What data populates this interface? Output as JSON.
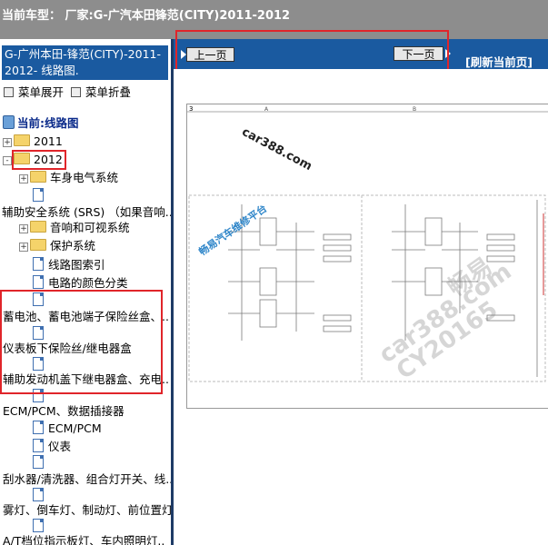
{
  "top_bar": {
    "text": "当前车型： 厂家:G-广汽本田锋范(CITY)2011-2012"
  },
  "left_panel": {
    "title": "G-广州本田-锋范(CITY)-2011-2012- 线路图.",
    "expand_label": "菜单展开",
    "collapse_label": "菜单折叠",
    "current_label": "当前:线路图",
    "tree": [
      {
        "label": "2011",
        "type": "folder",
        "toggle": "+"
      },
      {
        "label": "2012",
        "type": "folder",
        "toggle": "-"
      },
      {
        "label": "车身电气系统",
        "type": "folder",
        "toggle": "+"
      },
      {
        "label": "",
        "type": "doc"
      },
      {
        "label": "辅助安全系统 (SRS) （如果音响..",
        "type": "text"
      },
      {
        "label": "音响和可视系统",
        "type": "folder",
        "toggle": "+"
      },
      {
        "label": "保护系统",
        "type": "folder",
        "toggle": "+"
      },
      {
        "label": "线路图索引",
        "type": "doc"
      },
      {
        "label": "电路的颜色分类",
        "type": "doc"
      },
      {
        "label": "",
        "type": "doc"
      },
      {
        "label": "蓄电池、蓄电池端子保险丝盒、..",
        "type": "text"
      },
      {
        "label": "",
        "type": "doc"
      },
      {
        "label": "仪表板下保险丝/继电器盒",
        "type": "text"
      },
      {
        "label": "",
        "type": "doc"
      },
      {
        "label": "辅助发动机盖下继电器盒、充电..",
        "type": "text"
      },
      {
        "label": "",
        "type": "doc"
      },
      {
        "label": "ECM/PCM、数据插接器",
        "type": "text"
      },
      {
        "label": "ECM/PCM",
        "type": "doc"
      },
      {
        "label": "仪表",
        "type": "doc"
      },
      {
        "label": "",
        "type": "doc"
      },
      {
        "label": "刮水器/清洗器、组合灯开关、线..",
        "type": "text"
      },
      {
        "label": "",
        "type": "doc"
      },
      {
        "label": "雾灯、倒车灯、制动灯、前位置灯..",
        "type": "text"
      },
      {
        "label": "",
        "type": "doc"
      },
      {
        "label": "A/T档位指示板灯、车内照明灯..",
        "type": "text"
      }
    ]
  },
  "nav": {
    "prev_label": "上一页",
    "next_label": "下一页",
    "refresh_label": "[刷新当前页]"
  },
  "document": {
    "page_number": "3",
    "col_a": "A",
    "col_b": "B",
    "watermarks": {
      "car388": "car388.com",
      "platform": "畅易汽车维修平台",
      "big1": "畅易",
      "big2": "car388.com",
      "big3": "CY20165"
    }
  },
  "colors": {
    "top_bar": "#8d8d8d",
    "panel_blue": "#1a5aa0",
    "highlight_red": "#e0252a",
    "folder_yellow": "#f5d36a"
  }
}
